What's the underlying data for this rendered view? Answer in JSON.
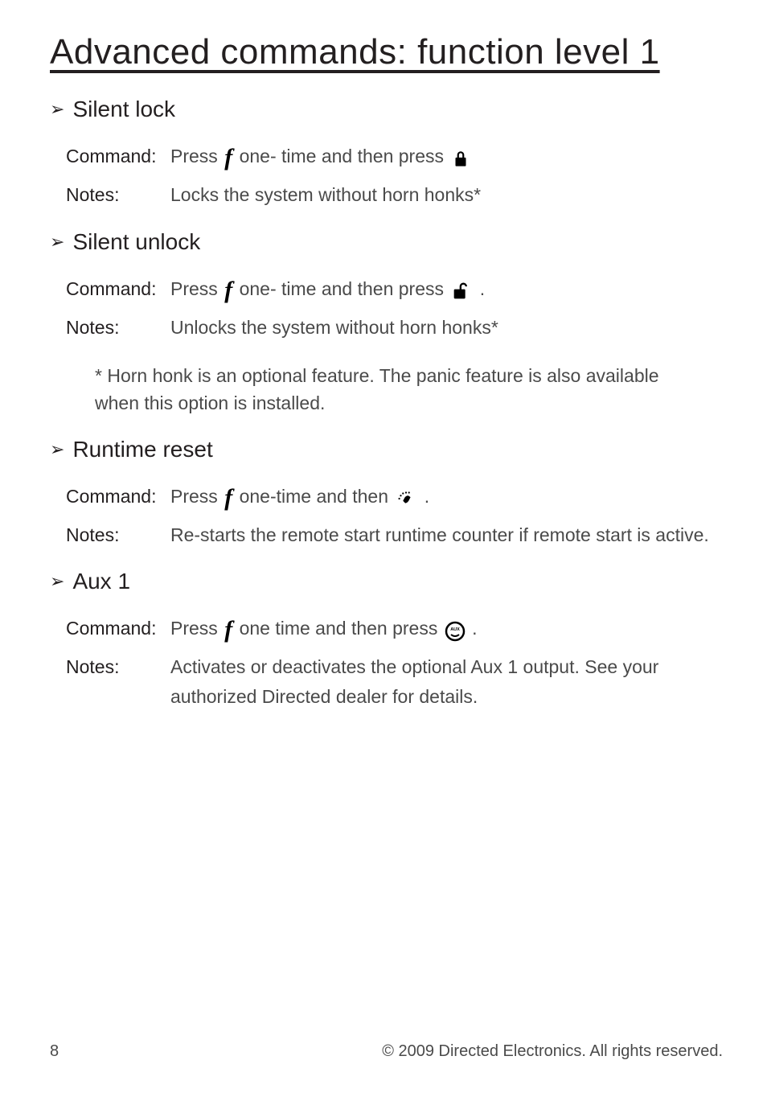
{
  "title": "Advanced commands: function level 1",
  "sections": {
    "silent_lock": {
      "heading": "Silent lock",
      "command_label": "Command",
      "command_pre": "Press ",
      "command_mid": " one- time and then press ",
      "notes_label": "Notes",
      "notes_text": "Locks the system without horn honks*"
    },
    "silent_unlock": {
      "heading": "Silent unlock",
      "command_label": "Command",
      "command_pre": "Press ",
      "command_mid": " one- time and then press ",
      "command_end": ".",
      "notes_label": "Notes",
      "notes_text": "Unlocks the system without horn honks*"
    },
    "footnote": "* Horn honk is an optional feature. The panic feature is also available when this option is installed.",
    "runtime_reset": {
      "heading": "Runtime reset",
      "command_label": "Command",
      "command_pre": "Press ",
      "command_mid": " one-time and then ",
      "command_end": ".",
      "notes_label": "Notes",
      "notes_text": "Re-starts the remote start runtime counter if remote start is active."
    },
    "aux1": {
      "heading": "Aux 1",
      "command_label": "Command",
      "command_pre": "Press ",
      "command_mid": " one time and then press ",
      "command_end": ".",
      "notes_label": "Notes",
      "notes_text": "Activates or deactivates the optional Aux 1 output. See your authorized Directed dealer for details."
    }
  },
  "footer": {
    "page": "8",
    "copyright": "© 2009 Directed Electronics. All rights reserved."
  }
}
